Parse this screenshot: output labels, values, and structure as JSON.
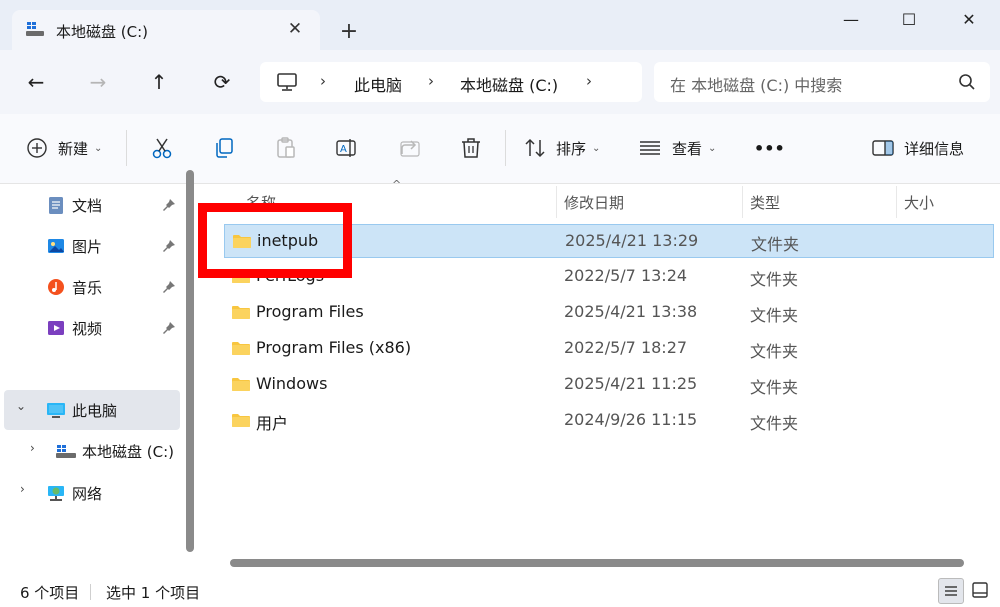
{
  "tab": {
    "title": "本地磁盘 (C:)",
    "close": "✕",
    "new_tab": "+"
  },
  "window": {
    "minimize": "—",
    "maximize": "☐",
    "close": "✕"
  },
  "nav": {
    "back": "←",
    "forward": "→",
    "up": "↑",
    "refresh": "⟳"
  },
  "address": {
    "chevron": "›",
    "crumbs": [
      "此电脑",
      "本地磁盘 (C:)"
    ]
  },
  "search": {
    "placeholder": "在 本地磁盘 (C:) 中搜索"
  },
  "toolbar": {
    "new_label": "新建",
    "sort_label": "排序",
    "view_label": "查看",
    "more_label": "•••",
    "details_label": "详细信息",
    "caret": "⌄"
  },
  "sidebar": {
    "quick": [
      {
        "label": "文档",
        "icon": "documents-icon"
      },
      {
        "label": "图片",
        "icon": "pictures-icon"
      },
      {
        "label": "音乐",
        "icon": "music-icon"
      },
      {
        "label": "视频",
        "icon": "videos-icon"
      }
    ],
    "this_pc": "此电脑",
    "drive": "本地磁盘 (C:)",
    "network": "网络",
    "expand_chevron": "›",
    "collapse_chevron": "⌄"
  },
  "columns": {
    "name": "名称",
    "date": "修改日期",
    "type": "类型",
    "size": "大小",
    "sort_indicator": "^"
  },
  "files": [
    {
      "name": "inetpub",
      "date": "2025/4/21 13:29",
      "type": "文件夹",
      "selected": true
    },
    {
      "name": "PerfLogs",
      "date": "2022/5/7 13:24",
      "type": "文件夹",
      "selected": false
    },
    {
      "name": "Program Files",
      "date": "2025/4/21 13:38",
      "type": "文件夹",
      "selected": false
    },
    {
      "name": "Program Files (x86)",
      "date": "2022/5/7 18:27",
      "type": "文件夹",
      "selected": false
    },
    {
      "name": "Windows",
      "date": "2025/4/21 11:25",
      "type": "文件夹",
      "selected": false
    },
    {
      "name": "用户",
      "date": "2024/9/26 11:15",
      "type": "文件夹",
      "selected": false
    }
  ],
  "status": {
    "count": "6 个项目",
    "selected": "选中 1 个项目"
  },
  "colors": {
    "folder": "#f8c640",
    "selection": "#cce4f7",
    "highlight_box": "#ff0000",
    "accent": "#0067c0"
  }
}
